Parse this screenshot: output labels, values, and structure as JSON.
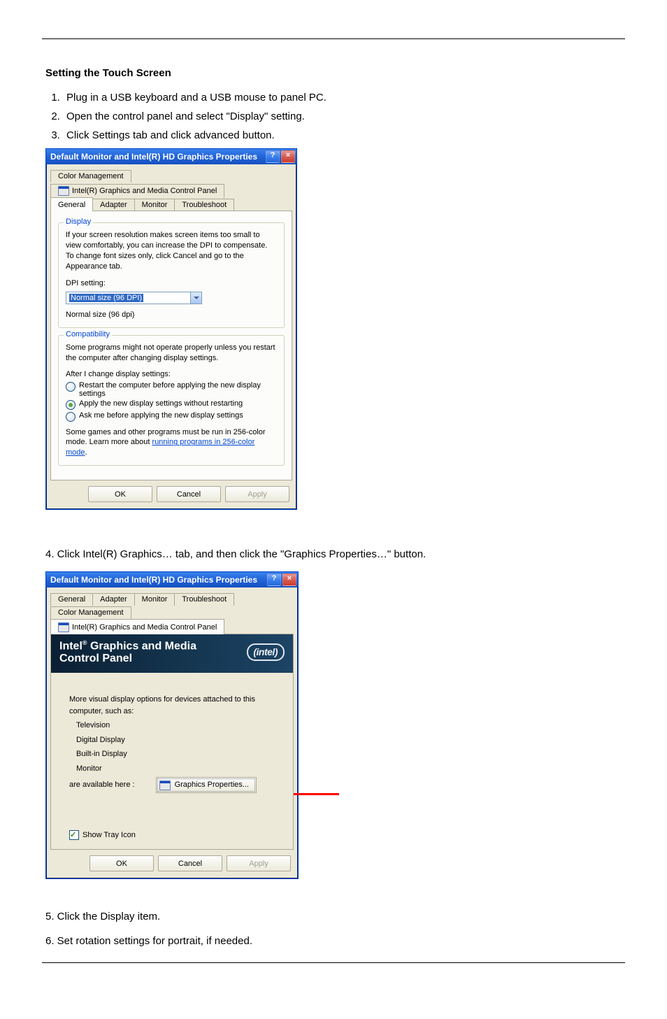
{
  "page": {
    "section_header": "Setting the Touch Screen",
    "step1": "Plug in a USB keyboard and a USB mouse to panel PC.",
    "step2": "Open the control panel and select \"Display\" setting.",
    "step3": "Click Settings tab and click advanced button.",
    "after_dialog1": "4. Click Intel(R) Graphics… tab, and then click the \"Graphics Properties…\" button.",
    "after_dialog2_a": "5. Click the Display item.",
    "after_dialog2_b": "6. Set rotation settings for portrait, if needed."
  },
  "dialog1": {
    "title": "Default Monitor and Intel(R) HD Graphics Properties",
    "tabs_row1": {
      "t1": "Color Management",
      "t2": "Intel(R) Graphics and Media Control Panel"
    },
    "tabs_row2": {
      "t1": "General",
      "t2": "Adapter",
      "t3": "Monitor",
      "t4": "Troubleshoot"
    },
    "display_group": {
      "legend": "Display",
      "body": "If your screen resolution makes screen items too small to view comfortably, you can increase the DPI to compensate. To change font sizes only, click Cancel and go to the Appearance tab.",
      "dpi_label": "DPI setting:",
      "dpi_value": "Normal size (96 DPI)",
      "normal_text": "Normal size (96 dpi)"
    },
    "compat_group": {
      "legend": "Compatibility",
      "body": "Some programs might not operate properly unless you restart the computer after changing display settings.",
      "after_label": "After I change display settings:",
      "opt1": "Restart the computer before applying the new display settings",
      "opt2": "Apply the new display settings without restarting",
      "opt3": "Ask me before applying the new display settings",
      "footer_a": "Some games and other programs must be run in 256-color mode. Learn more about ",
      "footer_link": "running programs in 256-color mode",
      "footer_b": "."
    },
    "buttons": {
      "ok": "OK",
      "cancel": "Cancel",
      "apply": "Apply"
    }
  },
  "dialog2": {
    "title": "Default Monitor and Intel(R) HD Graphics Properties",
    "tabs_row1": {
      "t1": "General",
      "t2": "Adapter",
      "t3": "Monitor",
      "t4": "Troubleshoot"
    },
    "tabs_row2": {
      "t1": "Color Management",
      "t2": "Intel(R) Graphics and Media Control Panel"
    },
    "banner_line1": "Intel",
    "banner_line1b": " Graphics and Media",
    "banner_line2": "Control Panel",
    "banner_pill": "intel",
    "intro": "More visual display options for devices attached to this computer, such as:",
    "items": {
      "a": "Television",
      "b": "Digital Display",
      "c": "Built-in Display",
      "d": "Monitor"
    },
    "available": "are available here :",
    "gfx_btn": "Graphics Properties...",
    "tray": "Show Tray Icon",
    "buttons": {
      "ok": "OK",
      "cancel": "Cancel",
      "apply": "Apply"
    }
  }
}
